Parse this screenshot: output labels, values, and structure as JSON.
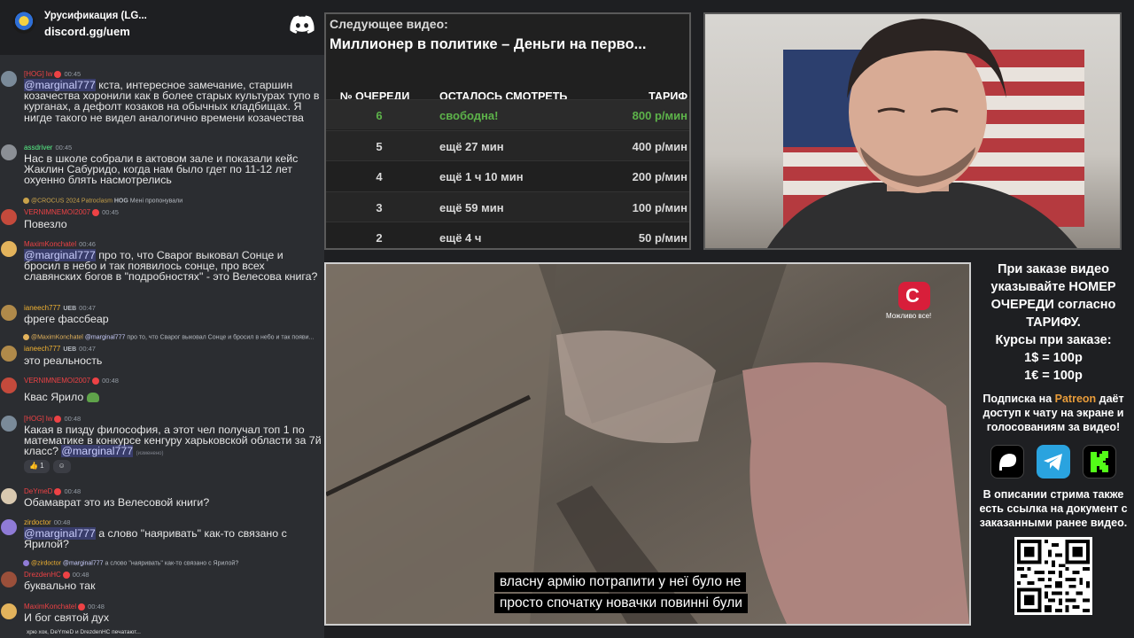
{
  "server": {
    "name": "Урусификация (LG...",
    "link": "discord.gg/uem"
  },
  "messages": [
    {
      "user": "[HOG] lw",
      "color": "#ed4245",
      "time": "00:45",
      "avatar_color": "#7a8a99",
      "mention": "@marginal777",
      "text": " кста, интересное замечание, старшин козачества хоронили как в более старых культурах тупо в курганах, а дефолт козаков на обычных кладбищах. Я нигде такого не видел аналогично времени козачества"
    },
    {
      "user": "assdriver",
      "color": "#57f287",
      "time": "00:45",
      "avatar_color": "#8b8f95",
      "text": "Нас в школе собрали в актовом зале и показали кейс Жаклин Сабуридо, когда нам было гдет по 11-12 лет охуенно блять насмотрелись"
    },
    {
      "reply_user": "@CROCUS 2024 Patroclasm",
      "reply_tag": "HOG",
      "reply_text": "Мені пропонували",
      "user": "VERNIMNEMOI2007",
      "color": "#ed4245",
      "time": "00:45",
      "avatar_color": "#c44a3c",
      "text": "Повезло"
    },
    {
      "user": "MaximKonchatel",
      "color": "#ed4245",
      "time": "00:46",
      "avatar_color": "#e3b35c",
      "mention": "@marginal777",
      "text": " про то, что Сварог выковал Сонце и бросил в небо и так появилось сонце, про всех славянских богов в \"подробностях\" - это Велесова книга?"
    },
    {
      "user": "ianeech777",
      "color": "#f0b232",
      "time": "00:47",
      "tag": "UEB",
      "avatar_color": "#b08a4a",
      "text": "фреге фассбеар"
    },
    {
      "reply_user": "@MaximKonchatel",
      "reply_mention": "@marginal777",
      "reply_text": " про то, что Сварог выковал Сонце и бросил в небо и так появи...",
      "user": "ianeech777",
      "color": "#f0b232",
      "time": "00:47",
      "tag": "UEB",
      "avatar_color": "#b08a4a",
      "text": "это реальность"
    },
    {
      "user": "VERNIMNEMOI2007",
      "color": "#ed4245",
      "time": "00:48",
      "avatar_color": "#c44a3c",
      "text": "Квас Ярило",
      "emoji": "frog"
    },
    {
      "user": "[HOG] lw",
      "color": "#ed4245",
      "time": "00:48",
      "avatar_color": "#7a8a99",
      "text": "Какая в пизду философия, а этот чел получал топ 1 по математике в конкурсе кенгуру харьковской области за 7й класс? ",
      "mention_end": "@marginal777",
      "edited": "(изменено)",
      "reactions": [
        "👍 1",
        "☺"
      ]
    },
    {
      "user": "DeYmeD",
      "color": "#ed4245",
      "time": "00:48",
      "avatar_color": "#d9c9b0",
      "text": "Обамаврат это из Велесовой книги?"
    },
    {
      "user": "zirdoctor",
      "color": "#f0b232",
      "time": "00:48",
      "avatar_color": "#8f7bd6",
      "mention": "@marginal777",
      "text": " а слово \"наяривать\" как-то связано с Ярилой?"
    },
    {
      "reply_user": "@zirdoctor",
      "reply_mention": "@marginal777",
      "reply_text": " а слово \"наяривать\" как-то связано с Ярилой?",
      "user": "DrezdenHC",
      "color": "#ed4245",
      "time": "00:48",
      "avatar_color": "#9a4f3a",
      "text": "буквально так"
    },
    {
      "user": "MaximKonchatel",
      "color": "#ed4245",
      "time": "00:48",
      "avatar_color": "#e3b35c",
      "text": "И бог святой дух"
    }
  ],
  "typing": "хрю хок, DeYmeD и DrezdenHC печатают...",
  "queue": {
    "heading": "Следующее видео:",
    "title": "Миллионер в политике – Деньги на перво...",
    "columns": [
      "№ ОЧЕРЕДИ",
      "ОСТАЛОСЬ СМОТРЕТЬ",
      "ТАРИФ"
    ],
    "rows": [
      {
        "num": "6",
        "left": "свободна!",
        "rate": "800 р/мин"
      },
      {
        "num": "5",
        "left": "ещё 27 мин",
        "rate": "400 р/мин"
      },
      {
        "num": "4",
        "left": "ещё 1 ч 10 мин",
        "rate": "200 р/мин"
      },
      {
        "num": "3",
        "left": "ещё 59 мин",
        "rate": "100 р/мин"
      },
      {
        "num": "2",
        "left": "ещё 4 ч",
        "rate": "50 р/мин"
      }
    ]
  },
  "video": {
    "subtitles": [
      "власну армію потрапити у неї було не",
      "просто спочатку новачки повинні були"
    ],
    "channel_logo": "С",
    "channel_slogan": "Можливо все!"
  },
  "info": {
    "main": "При заказе видео указывайте НОМЕР ОЧЕРЕДИ согласно ТАРИФУ.",
    "rates_title": "Курсы при заказе:",
    "rate_usd": "1$ = 100р",
    "rate_eur": "1€ = 100р",
    "sub_pre": "Подписка на ",
    "sub_brand": "Patreon",
    "sub_post": " даёт доступ к чату на экране и голосованиям за видео!",
    "desc": "В описании стрима также есть ссылка на документ с заказанными ранее видео.",
    "icons": [
      "patreon-icon",
      "telegram-icon",
      "kick-icon"
    ]
  }
}
